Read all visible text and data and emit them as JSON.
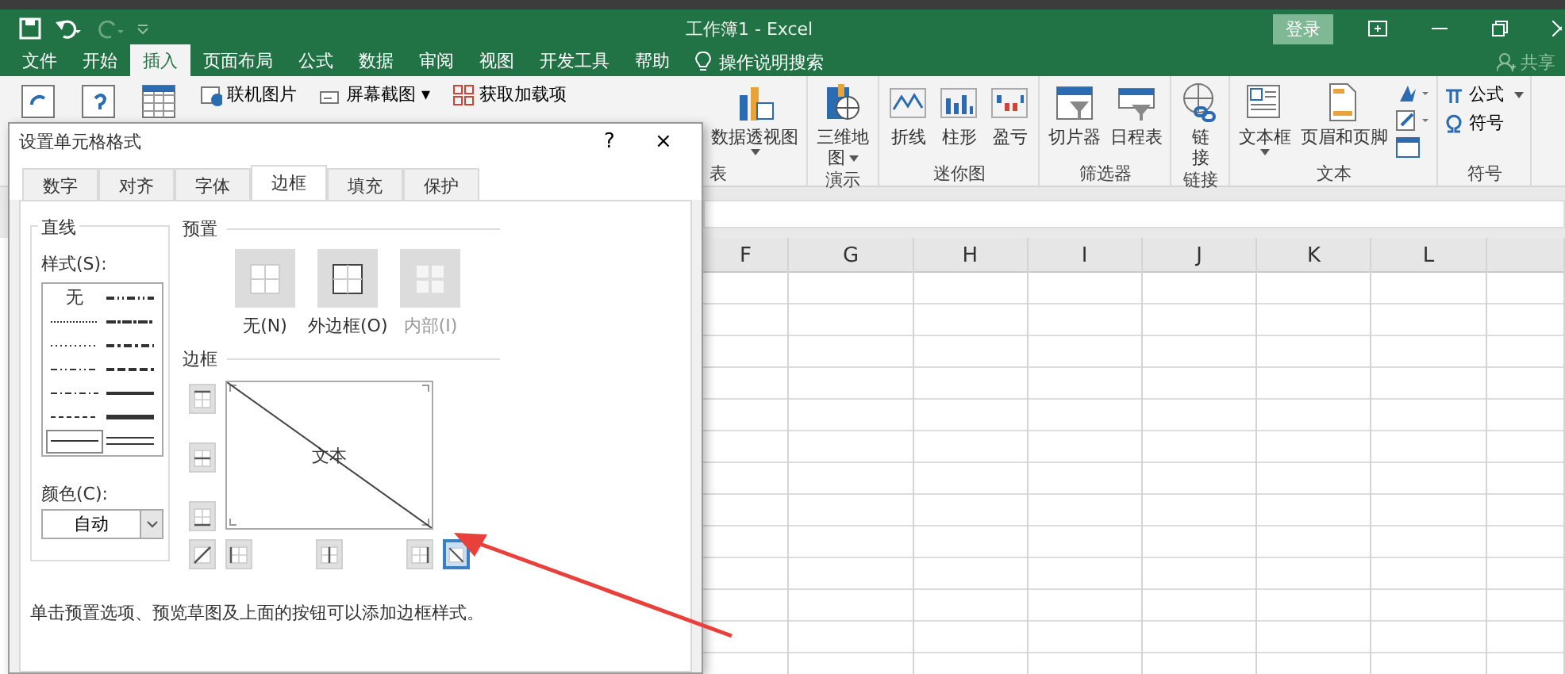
{
  "title_bar": {
    "title": "工作簿1  -  Excel",
    "login": "登录"
  },
  "menu_tabs": [
    {
      "label": "文件",
      "selected": false
    },
    {
      "label": "开始",
      "selected": false
    },
    {
      "label": "插入",
      "selected": true
    },
    {
      "label": "页面布局",
      "selected": false
    },
    {
      "label": "公式",
      "selected": false
    },
    {
      "label": "数据",
      "selected": false
    },
    {
      "label": "审阅",
      "selected": false
    },
    {
      "label": "视图",
      "selected": false
    },
    {
      "label": "开发工具",
      "selected": false
    },
    {
      "label": "帮助",
      "selected": false
    }
  ],
  "tell_me": "操作说明搜索",
  "share": "共享",
  "ribbon": {
    "top_items": [
      "联机图片",
      "屏幕截图 ▾",
      "获取加载项"
    ],
    "groups": [
      {
        "label": "表",
        "buttons": [
          {
            "kind": "large",
            "label": "数据透视图",
            "menu": true
          }
        ]
      },
      {
        "label": "演示",
        "buttons": [
          {
            "kind": "wrap",
            "label": "三维地图",
            "menu": true
          }
        ]
      },
      {
        "label": "迷你图",
        "buttons": [
          {
            "kind": "large",
            "label": "折线",
            "menu": false
          },
          {
            "kind": "large",
            "label": "柱形",
            "menu": false
          },
          {
            "kind": "large",
            "label": "盈亏",
            "menu": false
          }
        ]
      },
      {
        "label": "筛选器",
        "buttons": [
          {
            "kind": "large",
            "label": "切片器",
            "menu": false
          },
          {
            "kind": "large",
            "label": "日程表",
            "menu": false
          }
        ]
      },
      {
        "label": "链接",
        "buttons": [
          {
            "kind": "vertical",
            "label": "链接",
            "menu": false
          }
        ]
      },
      {
        "label": "文本",
        "buttons": [
          {
            "kind": "large",
            "label": "文本框",
            "menu": true
          },
          {
            "kind": "large",
            "label": "页眉和页脚",
            "menu": false
          },
          {
            "kind": "stack"
          }
        ]
      },
      {
        "label": "符号",
        "buttons": [
          {
            "kind": "small",
            "label": "公式",
            "menu": true
          },
          {
            "kind": "small",
            "label": "符号",
            "menu": false
          }
        ]
      }
    ]
  },
  "sheet": {
    "columns": [
      "F",
      "G",
      "H",
      "I",
      "J",
      "K",
      "L"
    ]
  },
  "dialog": {
    "title": "设置单元格格式",
    "help": "?",
    "close": "×",
    "tabs": [
      {
        "label": "数字",
        "selected": false
      },
      {
        "label": "对齐",
        "selected": false
      },
      {
        "label": "字体",
        "selected": false
      },
      {
        "label": "边框",
        "selected": true
      },
      {
        "label": "填充",
        "selected": false
      },
      {
        "label": "保护",
        "selected": false
      }
    ],
    "line": {
      "title": "直线",
      "style_label": "样式(S):",
      "styles": [
        {
          "kind": "none",
          "label": "无",
          "selected": false
        },
        {
          "kind": "mdashdotdot",
          "selected": false
        },
        {
          "kind": "hair",
          "selected": false
        },
        {
          "kind": "slant",
          "selected": false
        },
        {
          "kind": "dotted",
          "selected": false
        },
        {
          "kind": "mdashdot",
          "selected": false
        },
        {
          "kind": "dashdotdot",
          "selected": false
        },
        {
          "kind": "mdashed",
          "selected": false
        },
        {
          "kind": "dashdot",
          "selected": false
        },
        {
          "kind": "medium",
          "selected": false
        },
        {
          "kind": "dashed",
          "selected": false
        },
        {
          "kind": "thick",
          "selected": false
        },
        {
          "kind": "thin",
          "selected": true
        },
        {
          "kind": "double",
          "selected": false
        }
      ],
      "color_label": "颜色(C):",
      "color_value": "自动"
    },
    "presets_label": "预置",
    "presets": [
      {
        "kind": "none",
        "label": "无(N)",
        "disabled": false
      },
      {
        "kind": "outline",
        "label": "外边框(O)",
        "disabled": false
      },
      {
        "kind": "inside",
        "label": "内部(I)",
        "disabled": true
      }
    ],
    "border_label": "边框",
    "preview_text": "文本",
    "side_buttons": [
      {
        "kind": "top",
        "selected": false
      },
      {
        "kind": "hmiddle",
        "selected": false
      },
      {
        "kind": "bottom",
        "selected": false
      }
    ],
    "bottom_buttons": [
      {
        "kind": "diag_up",
        "selected": false
      },
      {
        "kind": "left",
        "selected": false
      },
      {
        "kind": "vmiddle",
        "selected": false
      },
      {
        "kind": "right",
        "selected": false
      },
      {
        "kind": "diag_down",
        "selected": true
      }
    ],
    "hint": "单击预置选项、预览草图及上面的按钮可以添加边框样式。"
  }
}
